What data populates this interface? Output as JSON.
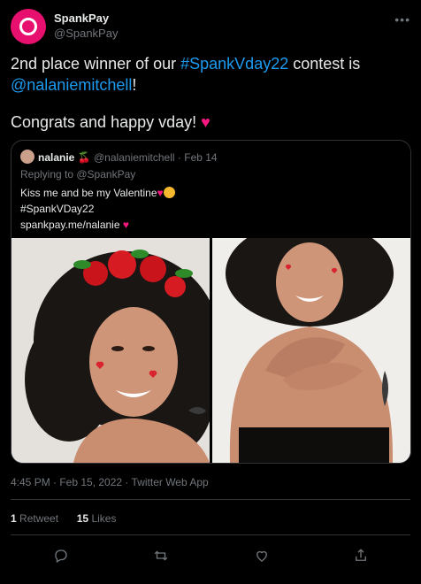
{
  "author": {
    "display_name": "SpankPay",
    "handle": "@SpankPay",
    "avatar_color": "#e8106f"
  },
  "tweet": {
    "text_prefix": "2nd place winner of our ",
    "hashtag": "#SpankVday22",
    "text_middle": " contest is",
    "mention": "@nalaniemitchell",
    "text_suffix": "!",
    "line2": "Congrats and happy vday!",
    "line2_emoji": "❤️"
  },
  "quote": {
    "name": "nalanie",
    "name_emoji": "🍒",
    "handle": "@nalaniemitchell",
    "separator": "·",
    "date": "Feb 14",
    "replying_prefix": "Replying to ",
    "replying_handle": "@SpankPay",
    "body_line1": "Kiss me and be my Valentine",
    "body_line1_emoji1": "❤️",
    "body_line2": "#SpankVDay22",
    "body_line3": "spankpay.me/nalanie",
    "body_line3_emoji": "❤️",
    "photos": [
      "photo-1",
      "photo-2"
    ]
  },
  "meta": {
    "time_line": "4:45 PM · Feb 15, 2022 · Twitter Web App"
  },
  "stats": {
    "retweets_count": "1",
    "retweets_label": "Retweet",
    "likes_count": "15",
    "likes_label": "Likes"
  },
  "actions": [
    "reply-icon",
    "retweet-icon",
    "like-icon",
    "share-icon"
  ],
  "colors": {
    "link": "#1d9bf0",
    "muted": "#71767b",
    "text": "#e7e9ea",
    "heart": "#f91880",
    "border": "#2f3336"
  }
}
